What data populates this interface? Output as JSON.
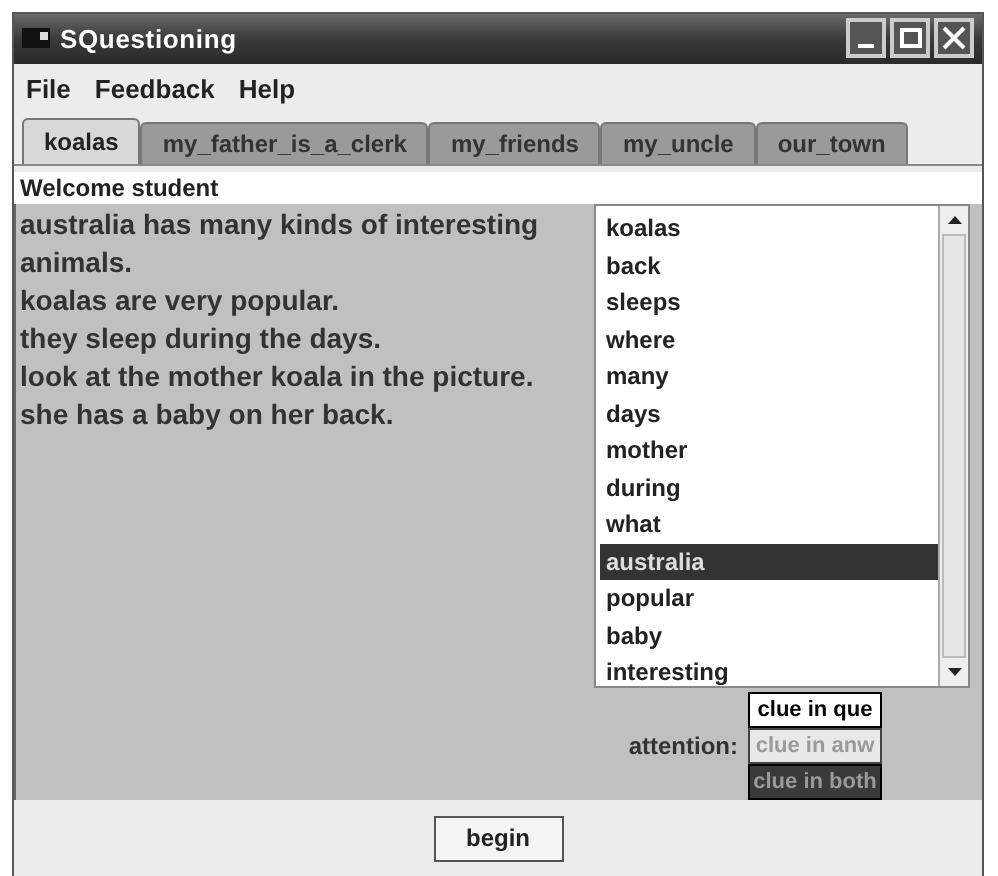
{
  "window": {
    "title": "SQuestioning"
  },
  "menu": [
    "File",
    "Feedback",
    "Help"
  ],
  "tabs": [
    {
      "label": "koalas",
      "selected": true
    },
    {
      "label": "my_father_is_a_clerk",
      "selected": false
    },
    {
      "label": "my_friends",
      "selected": false
    },
    {
      "label": "my_uncle",
      "selected": false
    },
    {
      "label": "our_town",
      "selected": false
    }
  ],
  "welcome": "Welcome student",
  "passage": [
    "australia has many kinds of interesting animals.",
    "koalas are very popular.",
    "they sleep during the days.",
    "look at the mother koala in the picture.",
    "she has a baby on her back."
  ],
  "word_list": [
    {
      "label": "koalas",
      "selected": false
    },
    {
      "label": "back",
      "selected": false
    },
    {
      "label": "sleeps",
      "selected": false
    },
    {
      "label": "where",
      "selected": false
    },
    {
      "label": "many",
      "selected": false
    },
    {
      "label": "days",
      "selected": false
    },
    {
      "label": "mother",
      "selected": false
    },
    {
      "label": "during",
      "selected": false
    },
    {
      "label": "what",
      "selected": false
    },
    {
      "label": "australia",
      "selected": true
    },
    {
      "label": "popular",
      "selected": false
    },
    {
      "label": "baby",
      "selected": false
    },
    {
      "label": "interesting",
      "selected": false
    }
  ],
  "attention": {
    "label": "attention:",
    "legend": [
      {
        "label": "clue in que",
        "kind": "question"
      },
      {
        "label": "clue in anw",
        "kind": "answer"
      },
      {
        "label": "clue in both",
        "kind": "both"
      }
    ]
  },
  "buttons": [
    "begin"
  ]
}
